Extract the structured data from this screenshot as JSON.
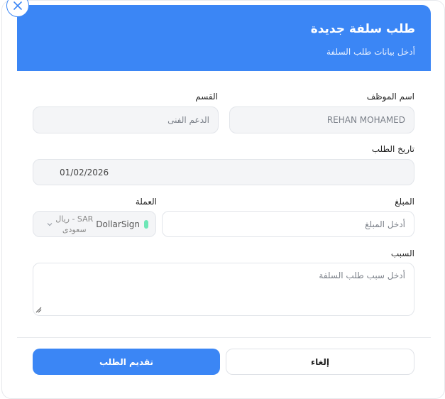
{
  "header": {
    "title": "طلب سلفة جديدة",
    "subtitle": "أدخل بيانات طلب السلفة"
  },
  "form": {
    "employee_name_label": "اسم الموظف",
    "employee_name_value": "REHAN MOHAMED",
    "department_label": "القسم",
    "department_value": "الدعم الفنى",
    "request_date_label": "تاريخ الطلب",
    "request_date_value": "01/02/2026",
    "amount_label": "المبلغ",
    "amount_placeholder": "أدخل المبلغ",
    "currency_label": "العملة",
    "currency_icon": "DollarSign",
    "currency_value_line1": "SAR - ريال",
    "currency_value_line2": "سعودى",
    "reason_label": "السبب",
    "reason_placeholder": "أدخل سبب طلب السلفة"
  },
  "actions": {
    "submit_label": "تقديم الطلب",
    "cancel_label": "إلغاء"
  },
  "colors": {
    "accent": "#3b86f5",
    "status_dot": "#6ee7b7"
  },
  "icons": {
    "close": "close-icon",
    "chevron": "chevron-down-icon",
    "resize": "resize-grip-icon"
  }
}
